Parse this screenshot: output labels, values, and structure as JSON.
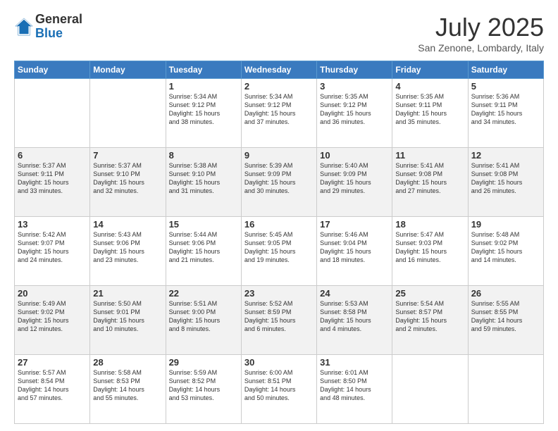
{
  "header": {
    "logo_general": "General",
    "logo_blue": "Blue",
    "month_year": "July 2025",
    "location": "San Zenone, Lombardy, Italy"
  },
  "days_of_week": [
    "Sunday",
    "Monday",
    "Tuesday",
    "Wednesday",
    "Thursday",
    "Friday",
    "Saturday"
  ],
  "weeks": [
    [
      {
        "day": "",
        "info": ""
      },
      {
        "day": "",
        "info": ""
      },
      {
        "day": "1",
        "info": "Sunrise: 5:34 AM\nSunset: 9:12 PM\nDaylight: 15 hours\nand 38 minutes."
      },
      {
        "day": "2",
        "info": "Sunrise: 5:34 AM\nSunset: 9:12 PM\nDaylight: 15 hours\nand 37 minutes."
      },
      {
        "day": "3",
        "info": "Sunrise: 5:35 AM\nSunset: 9:12 PM\nDaylight: 15 hours\nand 36 minutes."
      },
      {
        "day": "4",
        "info": "Sunrise: 5:35 AM\nSunset: 9:11 PM\nDaylight: 15 hours\nand 35 minutes."
      },
      {
        "day": "5",
        "info": "Sunrise: 5:36 AM\nSunset: 9:11 PM\nDaylight: 15 hours\nand 34 minutes."
      }
    ],
    [
      {
        "day": "6",
        "info": "Sunrise: 5:37 AM\nSunset: 9:11 PM\nDaylight: 15 hours\nand 33 minutes."
      },
      {
        "day": "7",
        "info": "Sunrise: 5:37 AM\nSunset: 9:10 PM\nDaylight: 15 hours\nand 32 minutes."
      },
      {
        "day": "8",
        "info": "Sunrise: 5:38 AM\nSunset: 9:10 PM\nDaylight: 15 hours\nand 31 minutes."
      },
      {
        "day": "9",
        "info": "Sunrise: 5:39 AM\nSunset: 9:09 PM\nDaylight: 15 hours\nand 30 minutes."
      },
      {
        "day": "10",
        "info": "Sunrise: 5:40 AM\nSunset: 9:09 PM\nDaylight: 15 hours\nand 29 minutes."
      },
      {
        "day": "11",
        "info": "Sunrise: 5:41 AM\nSunset: 9:08 PM\nDaylight: 15 hours\nand 27 minutes."
      },
      {
        "day": "12",
        "info": "Sunrise: 5:41 AM\nSunset: 9:08 PM\nDaylight: 15 hours\nand 26 minutes."
      }
    ],
    [
      {
        "day": "13",
        "info": "Sunrise: 5:42 AM\nSunset: 9:07 PM\nDaylight: 15 hours\nand 24 minutes."
      },
      {
        "day": "14",
        "info": "Sunrise: 5:43 AM\nSunset: 9:06 PM\nDaylight: 15 hours\nand 23 minutes."
      },
      {
        "day": "15",
        "info": "Sunrise: 5:44 AM\nSunset: 9:06 PM\nDaylight: 15 hours\nand 21 minutes."
      },
      {
        "day": "16",
        "info": "Sunrise: 5:45 AM\nSunset: 9:05 PM\nDaylight: 15 hours\nand 19 minutes."
      },
      {
        "day": "17",
        "info": "Sunrise: 5:46 AM\nSunset: 9:04 PM\nDaylight: 15 hours\nand 18 minutes."
      },
      {
        "day": "18",
        "info": "Sunrise: 5:47 AM\nSunset: 9:03 PM\nDaylight: 15 hours\nand 16 minutes."
      },
      {
        "day": "19",
        "info": "Sunrise: 5:48 AM\nSunset: 9:02 PM\nDaylight: 15 hours\nand 14 minutes."
      }
    ],
    [
      {
        "day": "20",
        "info": "Sunrise: 5:49 AM\nSunset: 9:02 PM\nDaylight: 15 hours\nand 12 minutes."
      },
      {
        "day": "21",
        "info": "Sunrise: 5:50 AM\nSunset: 9:01 PM\nDaylight: 15 hours\nand 10 minutes."
      },
      {
        "day": "22",
        "info": "Sunrise: 5:51 AM\nSunset: 9:00 PM\nDaylight: 15 hours\nand 8 minutes."
      },
      {
        "day": "23",
        "info": "Sunrise: 5:52 AM\nSunset: 8:59 PM\nDaylight: 15 hours\nand 6 minutes."
      },
      {
        "day": "24",
        "info": "Sunrise: 5:53 AM\nSunset: 8:58 PM\nDaylight: 15 hours\nand 4 minutes."
      },
      {
        "day": "25",
        "info": "Sunrise: 5:54 AM\nSunset: 8:57 PM\nDaylight: 15 hours\nand 2 minutes."
      },
      {
        "day": "26",
        "info": "Sunrise: 5:55 AM\nSunset: 8:55 PM\nDaylight: 14 hours\nand 59 minutes."
      }
    ],
    [
      {
        "day": "27",
        "info": "Sunrise: 5:57 AM\nSunset: 8:54 PM\nDaylight: 14 hours\nand 57 minutes."
      },
      {
        "day": "28",
        "info": "Sunrise: 5:58 AM\nSunset: 8:53 PM\nDaylight: 14 hours\nand 55 minutes."
      },
      {
        "day": "29",
        "info": "Sunrise: 5:59 AM\nSunset: 8:52 PM\nDaylight: 14 hours\nand 53 minutes."
      },
      {
        "day": "30",
        "info": "Sunrise: 6:00 AM\nSunset: 8:51 PM\nDaylight: 14 hours\nand 50 minutes."
      },
      {
        "day": "31",
        "info": "Sunrise: 6:01 AM\nSunset: 8:50 PM\nDaylight: 14 hours\nand 48 minutes."
      },
      {
        "day": "",
        "info": ""
      },
      {
        "day": "",
        "info": ""
      }
    ]
  ]
}
